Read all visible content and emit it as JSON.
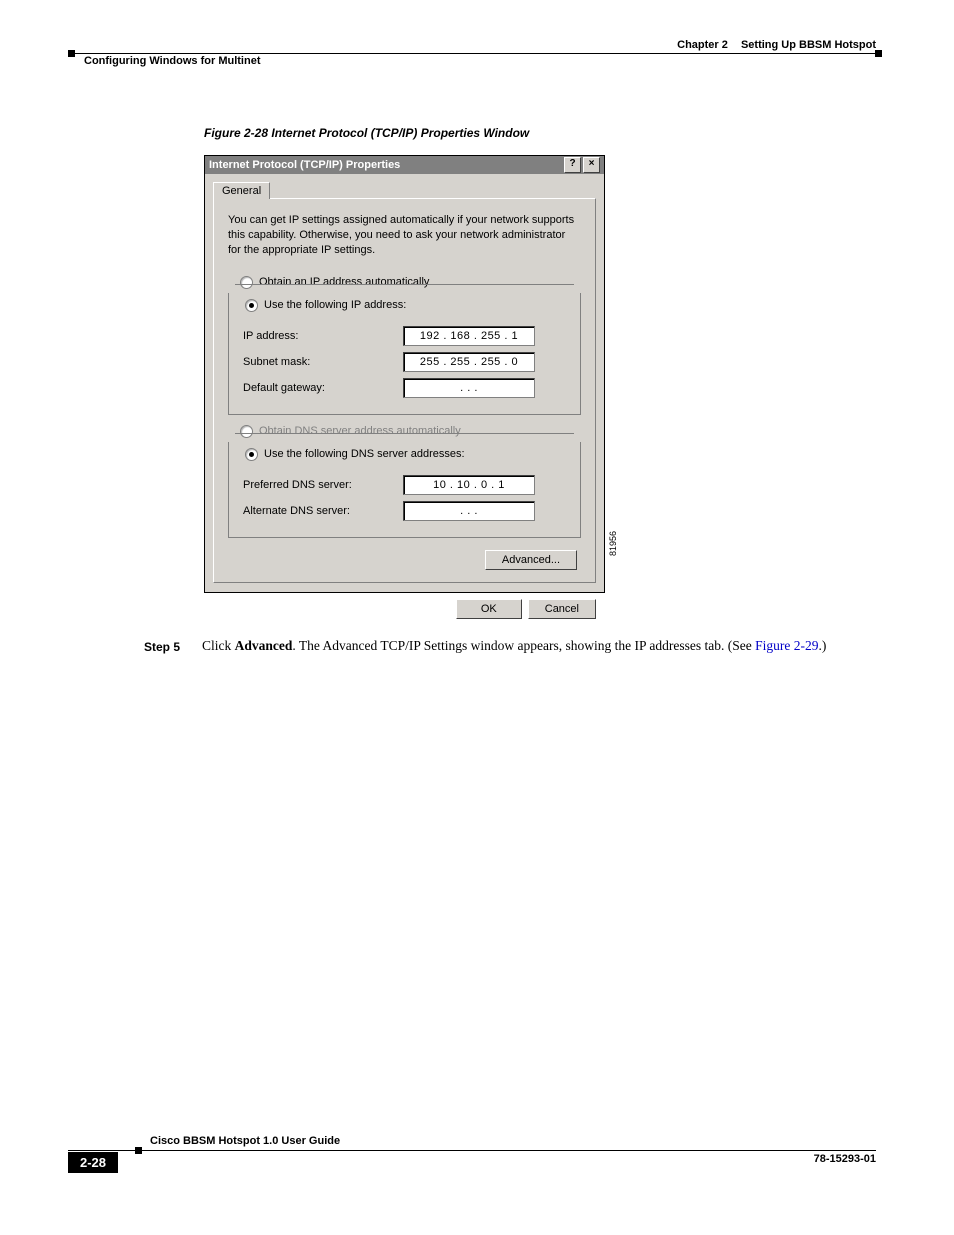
{
  "header": {
    "chapter_label": "Chapter 2",
    "chapter_title": "Setting Up BBSM Hotspot",
    "section_title": "Configuring Windows for Multinet"
  },
  "figure": {
    "caption": "Figure 2-28   Internet Protocol (TCP/IP) Properties Window",
    "id_label": "81956"
  },
  "dialog": {
    "title": "Internet Protocol (TCP/IP) Properties",
    "tab_label": "General",
    "description": "You can get IP settings assigned automatically if your network supports this capability. Otherwise, you need to ask your network administrator for the appropriate IP settings.",
    "ip_auto_label": "Obtain an IP address automatically",
    "ip_manual_label": "Use the following IP address:",
    "ip_address_label": "IP address:",
    "ip_address_value": "192 . 168 . 255 .   1",
    "subnet_label": "Subnet mask:",
    "subnet_value": "255 . 255 . 255 .   0",
    "gateway_label": "Default gateway:",
    "gateway_value": ".       .       .",
    "dns_auto_label": "Obtain DNS server address automatically",
    "dns_manual_label": "Use the following DNS server addresses:",
    "pref_dns_label": "Preferred DNS server:",
    "pref_dns_value": "10  .  10  .   0   .   1",
    "alt_dns_label": "Alternate DNS server:",
    "alt_dns_value": ".       .       .",
    "advanced_btn": "Advanced...",
    "ok_btn": "OK",
    "cancel_btn": "Cancel",
    "help_icon": "?",
    "close_icon": "×"
  },
  "step": {
    "label": "Step 5",
    "text_prefix": "Click ",
    "action_word": "Advanced",
    "text_mid": ". The Advanced TCP/IP Settings window appears, showing the IP addresses tab. (See ",
    "link_text": "Figure 2-29",
    "text_suffix": ".)"
  },
  "footer": {
    "guide_title": "Cisco BBSM Hotspot 1.0 User Guide",
    "page_number": "2-28",
    "doc_id": "78-15293-01"
  }
}
